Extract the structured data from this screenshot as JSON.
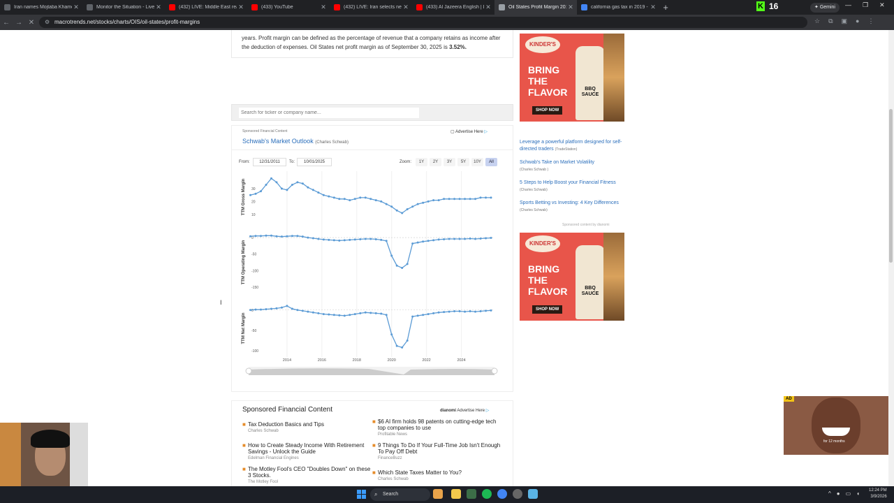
{
  "browser": {
    "tabs": [
      {
        "label": "Iran names Mojtaba Khamenei",
        "color": "#5f6368"
      },
      {
        "label": "Monitor the Situation - Live Gl",
        "color": "#5f6368"
      },
      {
        "label": "(432) LIVE: Middle East real-tim",
        "color": "#ff0000"
      },
      {
        "label": "(433) YouTube",
        "color": "#ff0000"
      },
      {
        "label": "(432) LIVE: Iran selects new sup",
        "color": "#ff0000"
      },
      {
        "label": "(433) Al Jazeera English | Liv",
        "color": "#ff0000"
      },
      {
        "label": "Oil States Profit Margin 2012-2",
        "color": "#9aa0a6",
        "active": true
      },
      {
        "label": "california gas tax in 2019 - Goo",
        "color": "#4285f4"
      }
    ],
    "new_tab": "+",
    "kick_count": "16",
    "gemini_label": "Gemini",
    "url": "macrotrends.net/stocks/charts/OIS/oil-states/profit-margins"
  },
  "page": {
    "intro_text": "years. Profit margin can be defined as the percentage of revenue that a company retains as income after the deduction of expenses. Oil States net profit margin as of September 30, 2025 is",
    "intro_value": "3.52%.",
    "search_placeholder": "Search for ticker or company name...",
    "sponsored_label": "Sponsored Financial Content",
    "advertise_here": "Advertise Here",
    "sponsor_title": "Schwab's Market Outlook",
    "sponsor_source": "(Charles Schwab)",
    "from_label": "From:",
    "from_value": "12/31/2011",
    "to_label": "To:",
    "to_value": "10/01/2025",
    "zoom_label": "Zoom:",
    "zoom_options": [
      "1Y",
      "2Y",
      "3Y",
      "5Y",
      "10Y",
      "All"
    ],
    "zoom_selected": "All"
  },
  "chart_data": {
    "type": "line",
    "x_tick_labels": [
      "2014",
      "2016",
      "2018",
      "2020",
      "2022",
      "2024"
    ],
    "panels": [
      {
        "ylabel": "TTM Gross Margin",
        "yticks": [
          "30",
          "20",
          "10"
        ],
        "ylim": [
          5,
          42
        ],
        "x": [
          2011.9,
          2012.2,
          2012.5,
          2012.8,
          2013.1,
          2013.4,
          2013.7,
          2014.0,
          2014.3,
          2014.6,
          2014.9,
          2015.2,
          2015.5,
          2015.8,
          2016.1,
          2016.4,
          2016.7,
          2017.0,
          2017.3,
          2017.6,
          2017.9,
          2018.2,
          2018.5,
          2018.8,
          2019.1,
          2019.4,
          2019.7,
          2020.0,
          2020.3,
          2020.6,
          2020.9,
          2021.2,
          2021.5,
          2021.8,
          2022.1,
          2022.4,
          2022.7,
          2023.0,
          2023.3,
          2023.6,
          2023.9,
          2024.2,
          2024.5,
          2024.8,
          2025.1,
          2025.4,
          2025.7
        ],
        "y": [
          25,
          26,
          28,
          33,
          38,
          35,
          30,
          29,
          33,
          35,
          34,
          31,
          29,
          27,
          25,
          24,
          23,
          22,
          22,
          21,
          22,
          23,
          23,
          22,
          21,
          20,
          18,
          16,
          13,
          11,
          14,
          16,
          18,
          19,
          20,
          21,
          21,
          22,
          22,
          22,
          22,
          22,
          22,
          22,
          23,
          23,
          23
        ]
      },
      {
        "ylabel": "TTM Operating Margin",
        "yticks": [
          "0",
          "-50",
          "-100",
          "-150"
        ],
        "ylim": [
          -165,
          15
        ],
        "x": [
          2011.9,
          2012.2,
          2012.5,
          2012.8,
          2013.1,
          2013.4,
          2013.7,
          2014.0,
          2014.3,
          2014.6,
          2014.9,
          2015.2,
          2015.5,
          2015.8,
          2016.1,
          2016.4,
          2016.7,
          2017.0,
          2017.3,
          2017.6,
          2017.9,
          2018.2,
          2018.5,
          2018.8,
          2019.1,
          2019.4,
          2019.7,
          2020.0,
          2020.3,
          2020.6,
          2020.9,
          2021.2,
          2021.5,
          2021.8,
          2022.1,
          2022.4,
          2022.7,
          2023.0,
          2023.3,
          2023.6,
          2023.9,
          2024.2,
          2024.5,
          2024.8,
          2025.1,
          2025.4,
          2025.7
        ],
        "y": [
          4,
          5,
          5,
          6,
          6,
          4,
          3,
          4,
          5,
          5,
          3,
          0,
          -2,
          -4,
          -6,
          -7,
          -8,
          -9,
          -8,
          -7,
          -6,
          -5,
          -4,
          -4,
          -5,
          -7,
          -10,
          -55,
          -85,
          -92,
          -80,
          -18,
          -15,
          -12,
          -10,
          -8,
          -6,
          -5,
          -4,
          -4,
          -4,
          -4,
          -3,
          -4,
          -3,
          -2,
          -1
        ],
        "zero_line": true
      },
      {
        "ylabel": "TTM Net Margin",
        "yticks": [
          "0",
          "-50",
          "-100"
        ],
        "ylim": [
          -105,
          15
        ],
        "x": [
          2011.9,
          2012.2,
          2012.5,
          2012.8,
          2013.1,
          2013.4,
          2013.7,
          2014.0,
          2014.3,
          2014.6,
          2014.9,
          2015.2,
          2015.5,
          2015.8,
          2016.1,
          2016.4,
          2016.7,
          2017.0,
          2017.3,
          2017.6,
          2017.9,
          2018.2,
          2018.5,
          2018.8,
          2019.1,
          2019.4,
          2019.7,
          2020.0,
          2020.3,
          2020.6,
          2020.9,
          2021.2,
          2021.5,
          2021.8,
          2022.1,
          2022.4,
          2022.7,
          2023.0,
          2023.3,
          2023.6,
          2023.9,
          2024.2,
          2024.5,
          2024.8,
          2025.1,
          2025.4,
          2025.7
        ],
        "y": [
          0,
          1,
          1,
          2,
          3,
          4,
          6,
          10,
          3,
          0,
          -2,
          -4,
          -6,
          -8,
          -10,
          -11,
          -12,
          -13,
          -14,
          -12,
          -10,
          -8,
          -6,
          -7,
          -8,
          -9,
          -12,
          -60,
          -88,
          -92,
          -75,
          -16,
          -14,
          -12,
          -10,
          -8,
          -6,
          -5,
          -4,
          -3,
          -3,
          -4,
          -3,
          -4,
          -3,
          -2,
          -1
        ],
        "zero_line": true
      }
    ],
    "xlim": [
      2011.8,
      2025.9
    ],
    "color": "#5b9bd5"
  },
  "ads": {
    "brand": "KINDER'S",
    "headline": "BRING THE FLAVOR",
    "cta": "SHOP NOW",
    "product": "BBQ SAUCE"
  },
  "side_links": [
    {
      "text": "Leverage a powerful platform designed for self-directed traders",
      "source": "(TradeStation)"
    },
    {
      "text": "Schwab's Take on Market Volatility",
      "source": "(Charles Schwab )"
    },
    {
      "text": "5 Steps to Help Boost your Financial Fitness",
      "source": "(Charles Schwab)"
    },
    {
      "text": "Sports Betting vs Investing: 4 Key Differences",
      "source": "(Charles Schwab)"
    }
  ],
  "sponsored_by": "Sponsored content by dianomi",
  "bottom": {
    "title": "Sponsored Financial Content",
    "advertise_here": "Advertise Here",
    "articles": [
      {
        "title": "Tax Deduction Basics and Tips",
        "source": "Charles Schwab"
      },
      {
        "title": "$6 AI firm holds 98 patents on cutting-edge tech top companies to use",
        "source": "Profitable News"
      },
      {
        "title": "How to Create Steady Income With Retirement Savings - Unlock the Guide",
        "source": "Edelman Financial Engines"
      },
      {
        "title": "9 Things To Do If Your Full-Time Job Isn't Enough To Pay Off Debt",
        "source": "FinanceBuzz"
      },
      {
        "title": "The Motley Fool's CEO \"Doubles Down\" on these 3 Stocks.",
        "source": "The Motley Fool"
      },
      {
        "title": "Which State Taxes Matter to You?",
        "source": "Charles Schwab"
      }
    ]
  },
  "video_ad": {
    "tag": "AD",
    "caption": "for 12 months"
  },
  "taskbar": {
    "search_label": "Search",
    "time": "12:24 PM",
    "date": "3/9/2026"
  }
}
